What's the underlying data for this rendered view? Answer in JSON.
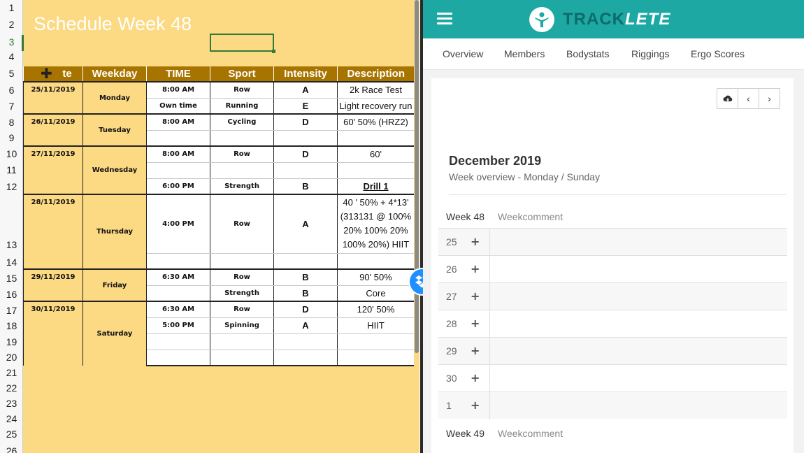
{
  "sheet": {
    "title": "Schedule Week 48",
    "row_numbers": [
      "1",
      "2",
      "3",
      "4",
      "5",
      "6",
      "7",
      "8",
      "9",
      "10",
      "11",
      "12",
      "13",
      "14",
      "15",
      "16",
      "17",
      "18",
      "19",
      "20",
      "21",
      "22",
      "23",
      "24",
      "25",
      "26"
    ],
    "headers": [
      "Date",
      "Weekday",
      "TIME",
      "Sport",
      "Intensity",
      "Description"
    ],
    "header_visible": [
      "",
      "Weekday",
      "TIME",
      "Sport",
      "Intensity",
      "Description"
    ],
    "header_partial": "te",
    "rows": [
      {
        "date": "25/11/2019",
        "weekday": "Monday",
        "time": "8:00 AM",
        "sport": "Row",
        "intensity": "A",
        "desc": "2k Race Test"
      },
      {
        "date": "",
        "weekday": "",
        "time": "Own time",
        "sport": "Running",
        "intensity": "E",
        "desc": "Light recovery run"
      },
      {
        "date": "26/11/2019",
        "weekday": "Tuesday",
        "time": "8:00 AM",
        "sport": "Cycling",
        "intensity": "D",
        "desc": "60' 50% (HRZ2)"
      },
      {
        "date": "",
        "weekday": "",
        "time": "",
        "sport": "",
        "intensity": "",
        "desc": ""
      },
      {
        "date": "27/11/2019",
        "weekday": "Wednesday",
        "time": "8:00 AM",
        "sport": "Row",
        "intensity": "D",
        "desc": "60'"
      },
      {
        "date": "",
        "weekday": "",
        "time": "",
        "sport": "",
        "intensity": "",
        "desc": ""
      },
      {
        "date": "",
        "weekday": "",
        "time": "6:00 PM",
        "sport": "Strength",
        "intensity": "B",
        "desc": "Drill 1"
      },
      {
        "date": "28/11/2019",
        "weekday": "Thursday",
        "time": "4:00 PM",
        "sport": "Row",
        "intensity": "A",
        "desc": "40 ' 50% + 4*13' (313131 @ 100% 20% 100% 20% 100% 20%) HIIT"
      },
      {
        "date": "",
        "weekday": "",
        "time": "",
        "sport": "",
        "intensity": "",
        "desc": ""
      },
      {
        "date": "29/11/2019",
        "weekday": "Friday",
        "time": "6:30 AM",
        "sport": "Row",
        "intensity": "B",
        "desc": "90' 50%"
      },
      {
        "date": "",
        "weekday": "",
        "time": "",
        "sport": "Strength",
        "intensity": "B",
        "desc": "Core"
      },
      {
        "date": "30/11/2019",
        "weekday": "Saturday",
        "time": "6:30 AM",
        "sport": "Row",
        "intensity": "D",
        "desc": "120' 50%"
      },
      {
        "date": "",
        "weekday": "",
        "time": "5:00 PM",
        "sport": "Spinning",
        "intensity": "A",
        "desc": "HIIT"
      }
    ]
  },
  "app": {
    "brand_track": "TRACK",
    "brand_lete": "LETE",
    "nav": [
      "Overview",
      "Members",
      "Bodystats",
      "Riggings",
      "Ergo Scores"
    ],
    "month": "December 2019",
    "week_overview": "Week overview - Monday / Sunday",
    "weeks": [
      {
        "label": "Week 48",
        "comment": "Weekcomment",
        "days": [
          "25",
          "26",
          "27",
          "28",
          "29",
          "30",
          "1"
        ]
      },
      {
        "label": "Week 49",
        "comment": "Weekcomment",
        "days": []
      }
    ],
    "add_symbol": "+",
    "colors": {
      "topbar": "#1ea8a4",
      "sheet_bg": "#fcd983",
      "header_bg": "#a87400"
    }
  }
}
